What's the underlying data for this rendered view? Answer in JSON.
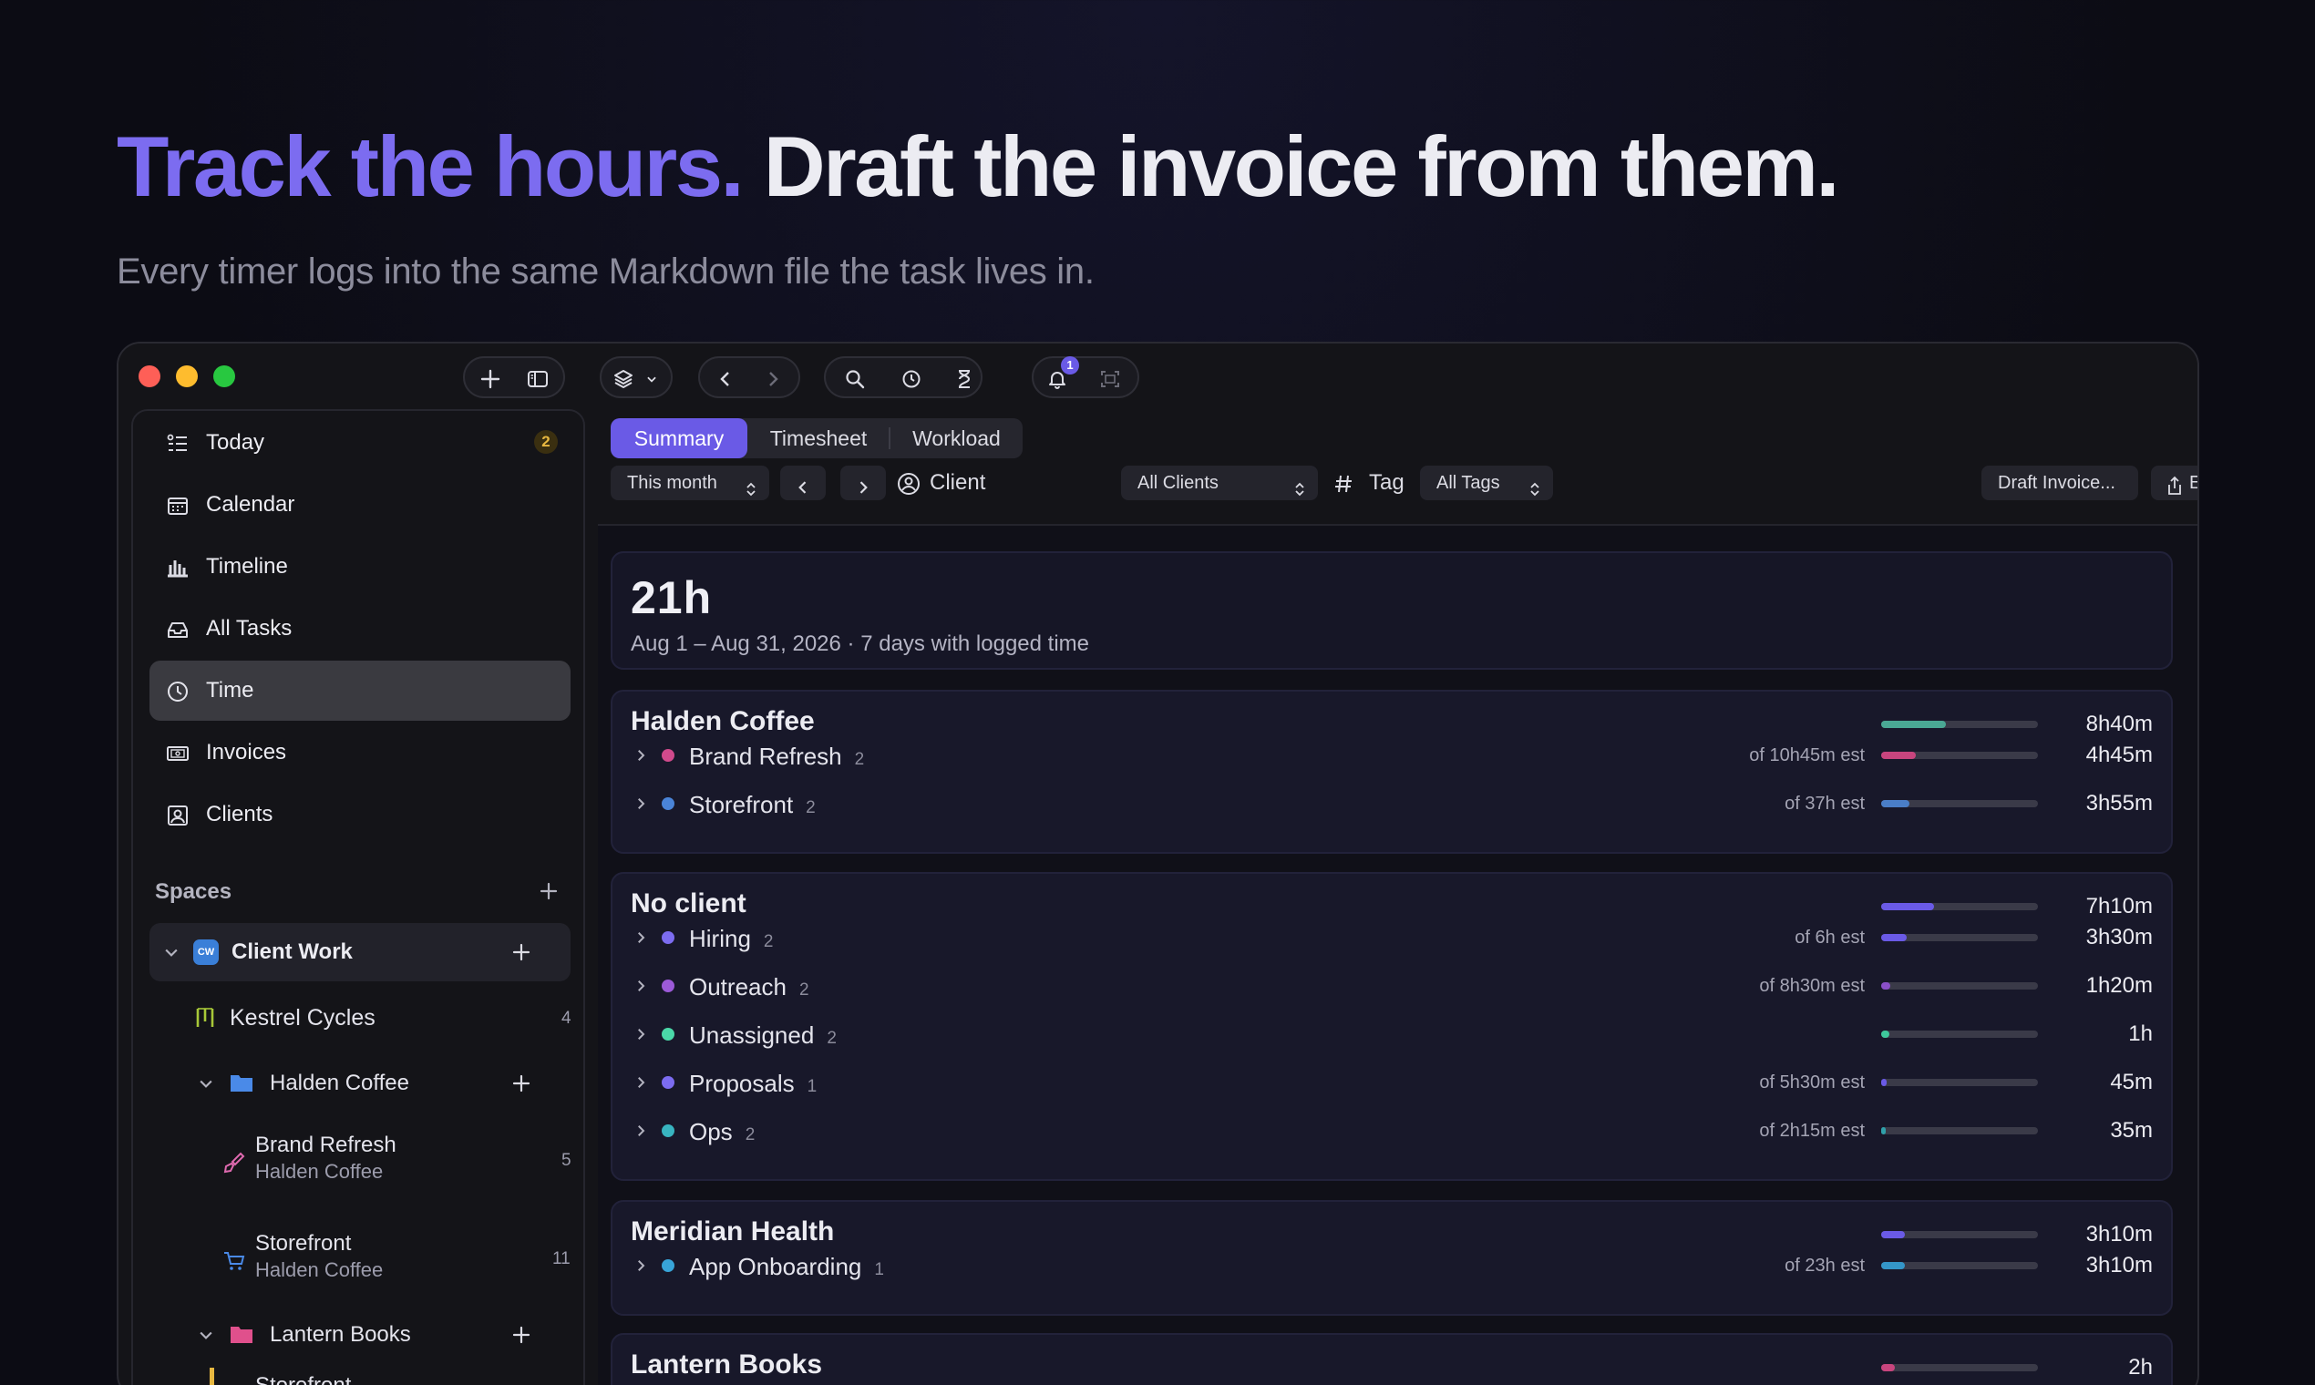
{
  "hero": {
    "headline_accent": "Track the hours.",
    "headline_rest": " Draft the invoice from them.",
    "subtitle": "Every timer logs into the same Markdown file the task lives in."
  },
  "colors": {
    "accent": "#6a5ae6",
    "bg": "#0c0c14",
    "traffic": [
      "#fe5f57",
      "#febc2e",
      "#28c840"
    ]
  },
  "toolbar": {
    "icons": [
      "plus-icon",
      "sidebar-toggle-icon",
      "layers-icon",
      "chevron-left-icon",
      "chevron-right-icon",
      "search-icon",
      "timer-icon",
      "hourglass-icon",
      "bell-icon",
      "expand-icon"
    ],
    "notification_count": "1"
  },
  "sidebar": {
    "items": [
      {
        "label": "Today",
        "icon": "today-list-icon",
        "badge": "2"
      },
      {
        "label": "Calendar",
        "icon": "calendar-icon"
      },
      {
        "label": "Timeline",
        "icon": "timeline-icon"
      },
      {
        "label": "All Tasks",
        "icon": "inbox-tray-icon"
      },
      {
        "label": "Time",
        "icon": "clock-icon",
        "active": true
      },
      {
        "label": "Invoices",
        "icon": "invoice-icon"
      },
      {
        "label": "Clients",
        "icon": "client-card-icon"
      }
    ],
    "spaces_title": "Spaces",
    "space": {
      "label": "Client Work",
      "abbrev": "CW"
    },
    "tree": [
      {
        "label": "Kestrel Cycles",
        "count": "4"
      },
      {
        "label": "Halden Coffee"
      },
      {
        "label": "Brand Refresh",
        "sub": "Halden Coffee",
        "count": "5"
      },
      {
        "label": "Storefront",
        "sub": "Halden Coffee",
        "count": "11"
      },
      {
        "label": "Lantern Books"
      },
      {
        "label": "Storefront"
      }
    ]
  },
  "tabs": [
    {
      "label": "Summary",
      "active": true
    },
    {
      "label": "Timesheet"
    },
    {
      "label": "Workload"
    }
  ],
  "filters": {
    "period": "This month",
    "client_label": "Client",
    "client_value": "All Clients",
    "tag_label": "Tag",
    "tag_value": "All Tags",
    "draft_invoice": "Draft Invoice...",
    "export": "Export"
  },
  "summary": {
    "total": "21h",
    "range": "Aug 1 – Aug 31, 2026 · 7 days with logged time"
  },
  "groups": [
    {
      "title": "Halden Coffee",
      "total": "8h40m",
      "fill": 0.41,
      "color": "#4aa894",
      "rows": [
        {
          "name": "Brand Refresh",
          "count": "2",
          "est": "of 10h45m est",
          "hours": "4h45m",
          "fill": 0.22,
          "dot": "#d04a8c",
          "color": "#c8457e"
        },
        {
          "name": "Storefront",
          "count": "2",
          "est": "of 37h est",
          "hours": "3h55m",
          "fill": 0.18,
          "dot": "#4a84d8",
          "color": "#4a7ec8"
        }
      ]
    },
    {
      "title": "No client",
      "total": "7h10m",
      "fill": 0.34,
      "color": "#6a5ae6",
      "rows": [
        {
          "name": "Hiring",
          "count": "2",
          "est": "of 6h est",
          "hours": "3h30m",
          "fill": 0.16,
          "dot": "#7c6cf0",
          "color": "#6a5ae6"
        },
        {
          "name": "Outreach",
          "count": "2",
          "est": "of 8h30m est",
          "hours": "1h20m",
          "fill": 0.06,
          "dot": "#9c5ad8",
          "color": "#8a50c8"
        },
        {
          "name": "Unassigned",
          "count": "2",
          "est": "",
          "hours": "1h",
          "fill": 0.05,
          "dot": "#4ad8a8",
          "color": "#3ec89c"
        },
        {
          "name": "Proposals",
          "count": "1",
          "est": "of 5h30m est",
          "hours": "45m",
          "fill": 0.035,
          "dot": "#7c6cf0",
          "color": "#6a5ae6"
        },
        {
          "name": "Ops",
          "count": "2",
          "est": "of 2h15m est",
          "hours": "35m",
          "fill": 0.028,
          "dot": "#38b4c0",
          "color": "#30a0aa"
        }
      ]
    },
    {
      "title": "Meridian Health",
      "total": "3h10m",
      "fill": 0.15,
      "color": "#6a5ae6",
      "rows": [
        {
          "name": "App Onboarding",
          "count": "1",
          "est": "of 23h est",
          "hours": "3h10m",
          "fill": 0.15,
          "dot": "#38a4d8",
          "color": "#3496c8"
        }
      ]
    },
    {
      "title": "Lantern Books",
      "total": "2h",
      "fill": 0.09,
      "color": "#c8457e",
      "rows": []
    }
  ]
}
